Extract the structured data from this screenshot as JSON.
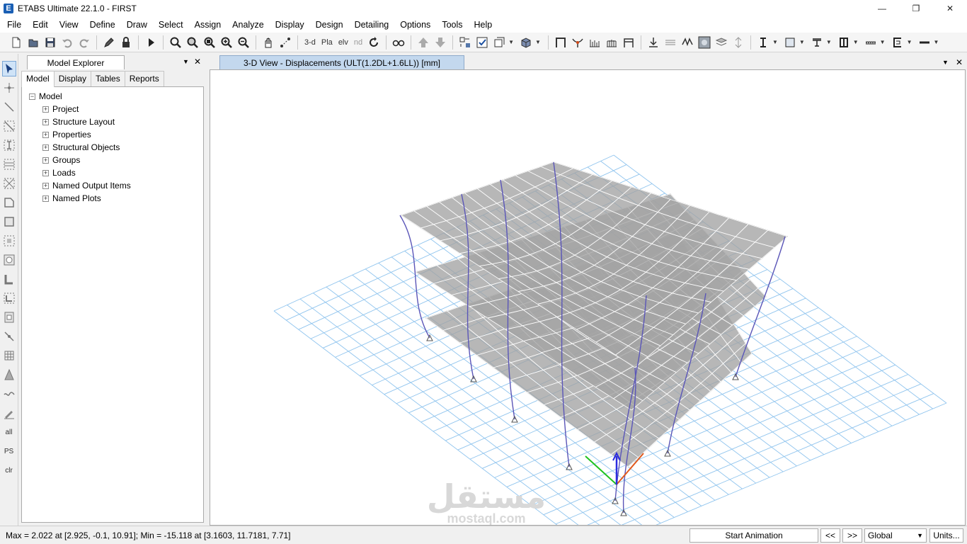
{
  "window": {
    "title": "ETABS Ultimate 22.1.0 - FIRST",
    "logo_letter": "E",
    "minimize": "—",
    "maximize": "❐",
    "close": "✕"
  },
  "menu": [
    "File",
    "Edit",
    "View",
    "Define",
    "Draw",
    "Select",
    "Assign",
    "Analyze",
    "Display",
    "Design",
    "Detailing",
    "Options",
    "Tools",
    "Help"
  ],
  "toolbar": {
    "view_3d_label": "3-d",
    "plan_label": "Pla",
    "elev_label": "elv",
    "nd_label": "nd"
  },
  "lefttools": {
    "all_label": "all",
    "ps_label": "PS",
    "clr_label": "clr"
  },
  "explorer": {
    "title": "Model Explorer",
    "dropdown": "▼",
    "close": "✕",
    "tabs": [
      "Model",
      "Display",
      "Tables",
      "Reports"
    ],
    "root": "Model",
    "items": [
      "Project",
      "Structure Layout",
      "Properties",
      "Structural Objects",
      "Groups",
      "Loads",
      "Named Output Items",
      "Named Plots"
    ]
  },
  "view": {
    "tab_title": "3-D View  - Displacements (ULT(1.2DL+1.6LL))  [mm]",
    "dropdown": "▼",
    "close": "✕"
  },
  "watermark": {
    "arabic": "مستقل",
    "latin": "mostaql.com"
  },
  "status": {
    "text": "Max = 2.022 at [2.925, -0.1, 10.91];  Min = -15.118 at [3.1603, 11.7181, 7.71]",
    "start_animation": "Start Animation",
    "prev": "<<",
    "next": ">>",
    "coord_system": "Global",
    "units": "Units..."
  },
  "colors": {
    "column": "#5b56b8",
    "slab": "#a3a3a3",
    "mesh": "#ffffff",
    "grid": "#8fc4ee",
    "axis_x": "#e05a1e",
    "axis_y": "#1fc21f",
    "axis_z": "#2b2be0"
  }
}
